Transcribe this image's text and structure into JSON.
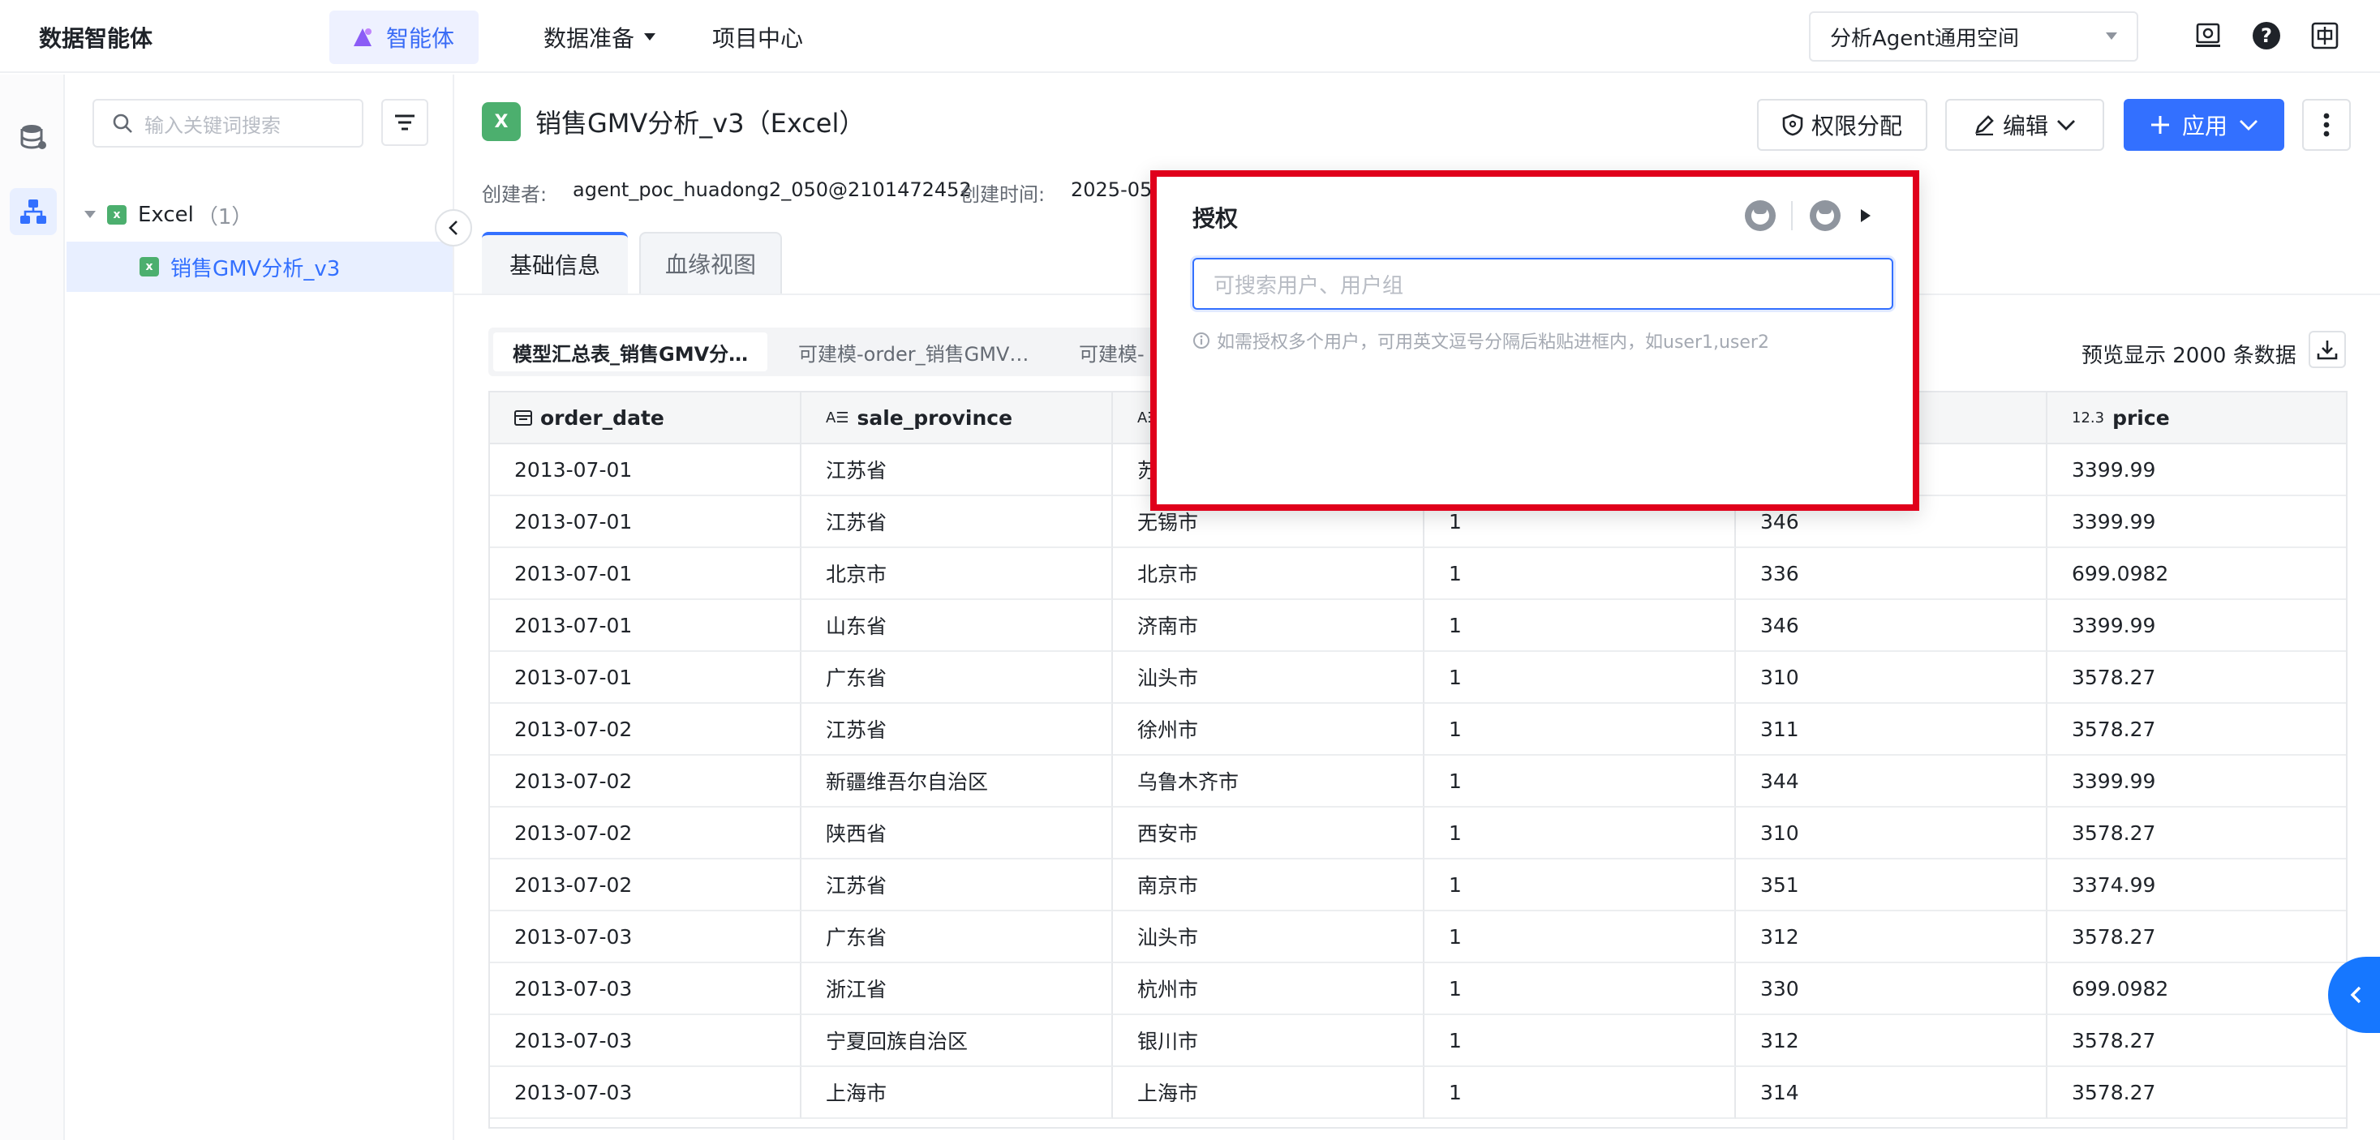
{
  "topbar": {
    "brand": "数据智能体",
    "nav_agent": "智能体",
    "nav_data_prep": "数据准备",
    "nav_project": "项目中心",
    "space": "分析Agent通用空间"
  },
  "tree": {
    "search_placeholder": "输入关键词搜索",
    "group_label": "Excel",
    "group_count": "（1）",
    "item_label": "销售GMV分析_v3"
  },
  "page": {
    "title": "销售GMV分析_v3（Excel）",
    "btn_permission": "权限分配",
    "btn_edit": "编辑",
    "btn_apply": "应用",
    "creator_label": "创建者:",
    "creator_value": "agent_poc_huadong2_050@2101472452",
    "created_label": "创建时间:",
    "created_value": "2025-05-"
  },
  "tabs": {
    "basic": "基础信息",
    "lineage": "血缘视图"
  },
  "subtabs": [
    "模型汇总表_销售GMV分…",
    "可建模-order_销售GMV…",
    "可建模-"
  ],
  "preview_text": "预览显示 2000 条数据",
  "table": {
    "columns": [
      {
        "name": "order_date",
        "type_icon": "calendar-icon"
      },
      {
        "name": "sale_province",
        "type_icon": "text-type-icon"
      },
      {
        "name": "",
        "type_icon": "text-type-icon"
      },
      {
        "name": "",
        "type_icon": ""
      },
      {
        "name": "",
        "type_icon": ""
      },
      {
        "name": "price",
        "type_icon": "number-type-icon"
      }
    ],
    "type_glyphs": {
      "text": "A☰",
      "number": "12.3"
    },
    "rows": [
      [
        "2013-07-01",
        "江苏省",
        "苏",
        "",
        "",
        "3399.99"
      ],
      [
        "2013-07-01",
        "江苏省",
        "无锡市",
        "1",
        "346",
        "3399.99"
      ],
      [
        "2013-07-01",
        "北京市",
        "北京市",
        "1",
        "336",
        "699.0982"
      ],
      [
        "2013-07-01",
        "山东省",
        "济南市",
        "1",
        "346",
        "3399.99"
      ],
      [
        "2013-07-01",
        "广东省",
        "汕头市",
        "1",
        "310",
        "3578.27"
      ],
      [
        "2013-07-02",
        "江苏省",
        "徐州市",
        "1",
        "311",
        "3578.27"
      ],
      [
        "2013-07-02",
        "新疆维吾尔自治区",
        "乌鲁木齐市",
        "1",
        "344",
        "3399.99"
      ],
      [
        "2013-07-02",
        "陕西省",
        "西安市",
        "1",
        "310",
        "3578.27"
      ],
      [
        "2013-07-02",
        "江苏省",
        "南京市",
        "1",
        "351",
        "3374.99"
      ],
      [
        "2013-07-03",
        "广东省",
        "汕头市",
        "1",
        "312",
        "3578.27"
      ],
      [
        "2013-07-03",
        "浙江省",
        "杭州市",
        "1",
        "330",
        "699.0982"
      ],
      [
        "2013-07-03",
        "宁夏回族自治区",
        "银川市",
        "1",
        "312",
        "3578.27"
      ],
      [
        "2013-07-03",
        "上海市",
        "上海市",
        "1",
        "314",
        "3578.27"
      ]
    ]
  },
  "popup": {
    "title": "授权",
    "input_placeholder": "可搜索用户、用户组",
    "hint": "如需授权多个用户，可用英文逗号分隔后粘贴进框内，如user1,user2"
  },
  "colors": {
    "accent": "#3370ff",
    "highlight_border": "#e0001b",
    "excel_green": "#4caf6e"
  }
}
